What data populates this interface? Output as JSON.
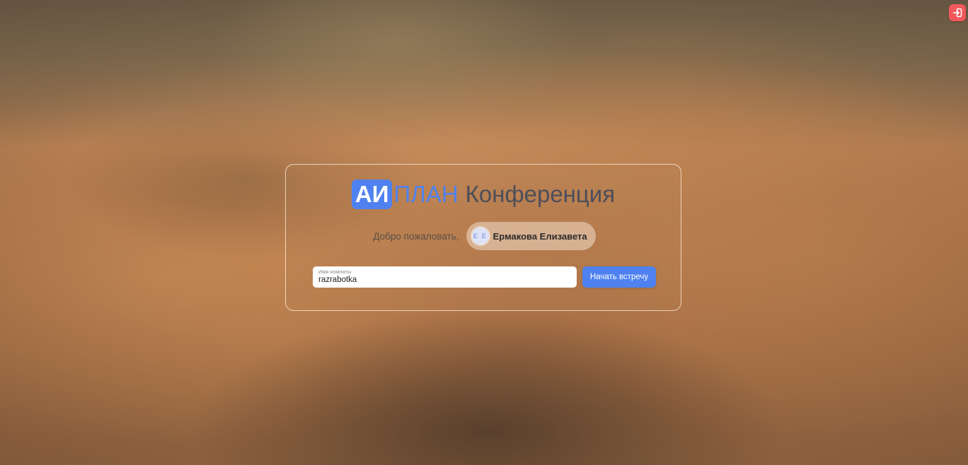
{
  "header": {
    "exit_icon": "sign-in-box-icon",
    "exit_button_color": "#f0585c"
  },
  "brand": {
    "logo_ai": "АИ",
    "logo_plan": "ПЛАН",
    "title": "Конференция",
    "accent_color": "#4f82f0"
  },
  "welcome": {
    "text": "Добро пожаловать,",
    "user": {
      "initials": "Е Е",
      "name": "Ермакова Елизавета"
    }
  },
  "room": {
    "label": "Имя комнаты",
    "value": "razrabotka"
  },
  "actions": {
    "start_label": "Начать встречу"
  }
}
